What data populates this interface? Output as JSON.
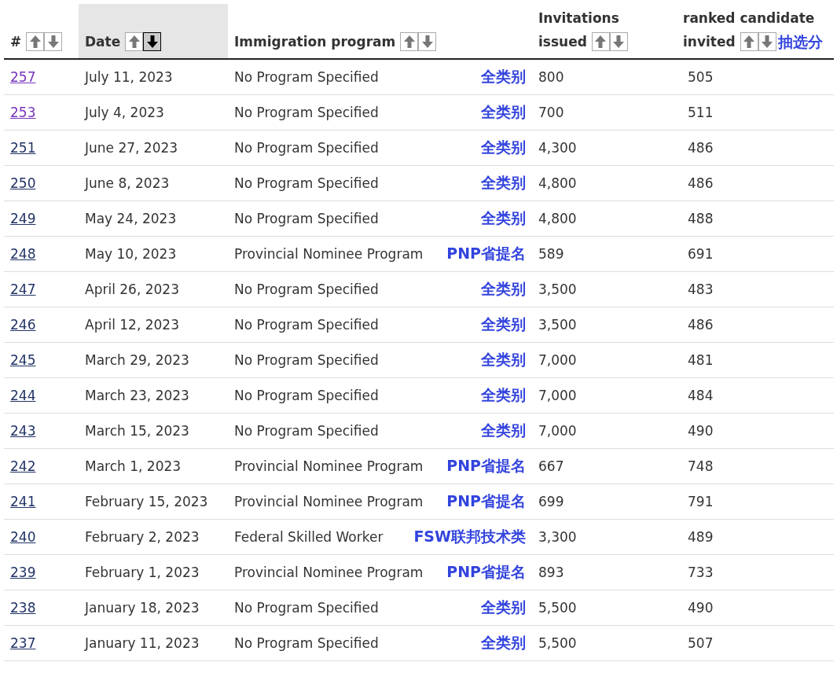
{
  "table": {
    "columns": [
      {
        "label_lines": [
          "#"
        ],
        "selected": false,
        "sort_buttons": [
          {
            "selected": false
          },
          {
            "selected": false
          }
        ]
      },
      {
        "label_lines": [
          "Date"
        ],
        "selected": true,
        "sort_buttons": [
          {
            "selected": false
          },
          {
            "selected": true
          }
        ]
      },
      {
        "label_lines": [
          "Immigration program"
        ],
        "selected": false,
        "sort_buttons": [
          {
            "selected": false
          },
          {
            "selected": false
          }
        ]
      },
      {
        "label_lines": [
          "Invitations",
          "issued"
        ],
        "selected": false,
        "sort_buttons": [
          {
            "selected": false
          },
          {
            "selected": false
          }
        ]
      },
      {
        "label_lines": [
          "ranked candidate",
          "invited"
        ],
        "selected": false,
        "sort_buttons": [
          {
            "selected": false
          },
          {
            "selected": false
          }
        ],
        "note": "抽选分"
      }
    ],
    "rows": [
      {
        "number": "257",
        "visited": true,
        "date": "July 11, 2023",
        "program": "No Program Specified",
        "note": "全类别",
        "invitations": "800",
        "score": "505"
      },
      {
        "number": "253",
        "visited": true,
        "date": "July 4, 2023",
        "program": "No Program Specified",
        "note": "全类别",
        "invitations": "700",
        "score": "511"
      },
      {
        "number": "251",
        "visited": false,
        "date": "June 27, 2023",
        "program": "No Program Specified",
        "note": "全类别",
        "invitations": "4,300",
        "score": "486"
      },
      {
        "number": "250",
        "visited": false,
        "date": "June 8, 2023",
        "program": "No Program Specified",
        "note": "全类别",
        "invitations": "4,800",
        "score": "486"
      },
      {
        "number": "249",
        "visited": false,
        "date": "May 24, 2023",
        "program": "No Program Specified",
        "note": "全类别",
        "invitations": "4,800",
        "score": "488"
      },
      {
        "number": "248",
        "visited": false,
        "date": "May 10, 2023",
        "program": "Provincial Nominee Program",
        "note": "PNP省提名",
        "invitations": "589",
        "score": "691"
      },
      {
        "number": "247",
        "visited": false,
        "date": "April 26, 2023",
        "program": "No Program Specified",
        "note": "全类别",
        "invitations": "3,500",
        "score": "483"
      },
      {
        "number": "246",
        "visited": false,
        "date": "April 12, 2023",
        "program": "No Program Specified",
        "note": "全类别",
        "invitations": "3,500",
        "score": "486"
      },
      {
        "number": "245",
        "visited": false,
        "date": "March 29, 2023",
        "program": "No Program Specified",
        "note": "全类别",
        "invitations": "7,000",
        "score": "481"
      },
      {
        "number": "244",
        "visited": false,
        "date": "March 23, 2023",
        "program": "No Program Specified",
        "note": "全类别",
        "invitations": "7,000",
        "score": "484"
      },
      {
        "number": "243",
        "visited": false,
        "date": "March 15, 2023",
        "program": "No Program Specified",
        "note": "全类别",
        "invitations": "7,000",
        "score": "490"
      },
      {
        "number": "242",
        "visited": false,
        "date": "March 1, 2023",
        "program": "Provincial Nominee Program",
        "note": "PNP省提名",
        "invitations": "667",
        "score": "748"
      },
      {
        "number": "241",
        "visited": false,
        "date": "February 15, 2023",
        "program": "Provincial Nominee Program",
        "note": "PNP省提名",
        "invitations": "699",
        "score": "791"
      },
      {
        "number": "240",
        "visited": false,
        "date": "February 2, 2023",
        "program": "Federal Skilled Worker",
        "note": "FSW联邦技术类",
        "invitations": "3,300",
        "score": "489"
      },
      {
        "number": "239",
        "visited": false,
        "date": "February 1, 2023",
        "program": "Provincial Nominee Program",
        "note": "PNP省提名",
        "invitations": "893",
        "score": "733"
      },
      {
        "number": "238",
        "visited": false,
        "date": "January 18, 2023",
        "program": "No Program Specified",
        "note": "全类别",
        "invitations": "5,500",
        "score": "490"
      },
      {
        "number": "237",
        "visited": false,
        "date": "January 11, 2023",
        "program": "No Program Specified",
        "note": "全类别",
        "invitations": "5,500",
        "score": "507"
      }
    ]
  }
}
